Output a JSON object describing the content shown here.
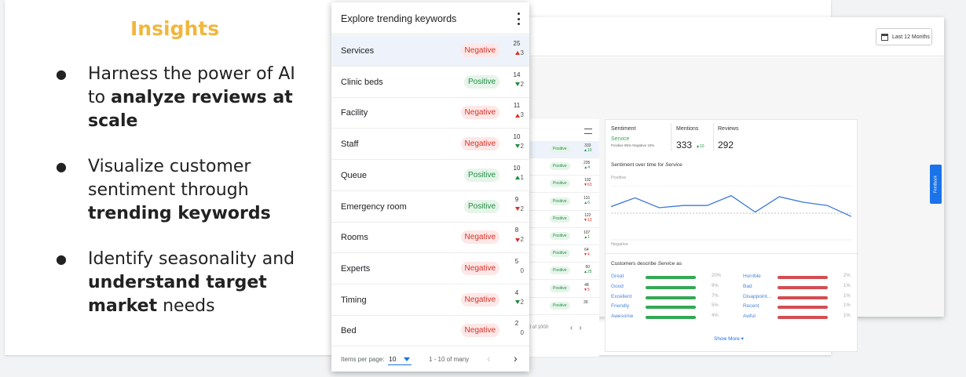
{
  "slide": {
    "title": "Insights",
    "bullets": [
      {
        "parts": [
          {
            "t": "Harness the power of AI to ",
            "b": false
          },
          {
            "t": "analyze reviews at scale",
            "b": true
          }
        ]
      },
      {
        "parts": [
          {
            "t": "Visualize customer sentiment through ",
            "b": false
          },
          {
            "t": "trending keywords",
            "b": true
          }
        ]
      },
      {
        "parts": [
          {
            "t": "Identify seasonality and ",
            "b": false
          },
          {
            "t": "understand target market",
            "b": true
          },
          {
            "t": " needs",
            "b": false
          }
        ]
      }
    ]
  },
  "panel": {
    "title": "Explore trending keywords",
    "rows": [
      {
        "label": "Services",
        "sentiment": "Negative",
        "count": "25",
        "delta": "3",
        "dir": "up-red",
        "selected": true
      },
      {
        "label": "Clinic beds",
        "sentiment": "Positive",
        "count": "14",
        "delta": "2",
        "dir": "down-green",
        "selected": false
      },
      {
        "label": "Facility",
        "sentiment": "Negative",
        "count": "11",
        "delta": "3",
        "dir": "up-red",
        "selected": false
      },
      {
        "label": "Staff",
        "sentiment": "Negative",
        "count": "10",
        "delta": "2",
        "dir": "down-green",
        "selected": false
      },
      {
        "label": "Queue",
        "sentiment": "Positive",
        "count": "10",
        "delta": "1",
        "dir": "up-green",
        "selected": false
      },
      {
        "label": "Emergency room",
        "sentiment": "Positive",
        "count": "9",
        "delta": "2",
        "dir": "down-red",
        "selected": false
      },
      {
        "label": "Rooms",
        "sentiment": "Negative",
        "count": "8",
        "delta": "2",
        "dir": "down-red",
        "selected": false
      },
      {
        "label": "Experts",
        "sentiment": "Negative",
        "count": "5",
        "delta": "0",
        "dir": "none",
        "selected": false
      },
      {
        "label": "Timing",
        "sentiment": "Negative",
        "count": "4",
        "delta": "2",
        "dir": "down-green",
        "selected": false
      },
      {
        "label": "Bed",
        "sentiment": "Negative",
        "count": "2",
        "delta": "0",
        "dir": "none",
        "selected": false
      }
    ],
    "footer": {
      "items_per_page_label": "Items per page:",
      "items_per_page_value": "10",
      "range": "1 - 10 of many",
      "prev": "‹",
      "next": "›"
    }
  },
  "dashboard": {
    "date_button": "Last 12 Months",
    "table_rows": [
      {
        "pill": "Positive",
        "count": "333",
        "delta": "10",
        "dir": "up"
      },
      {
        "pill": "Positive",
        "count": "235",
        "delta": "4",
        "dir": "up"
      },
      {
        "pill": "Positive",
        "count": "192",
        "delta": "63",
        "dir": "down"
      },
      {
        "pill": "Positive",
        "count": "131",
        "delta": "6",
        "dir": "up"
      },
      {
        "pill": "Positive",
        "count": "122",
        "delta": "13",
        "dir": "down"
      },
      {
        "pill": "Positive",
        "count": "107",
        "delta": "1",
        "dir": "up"
      },
      {
        "pill": "Positive",
        "count": "64",
        "delta": "4",
        "dir": "down"
      },
      {
        "pill": "Positive",
        "count": "60",
        "delta": "25",
        "dir": "up"
      },
      {
        "pill": "Positive",
        "count": "48",
        "delta": "5",
        "dir": "down"
      },
      {
        "pill": "Positive",
        "count": "39",
        "delta": "",
        "dir": "none"
      }
    ],
    "table_range": "- 10 of 1000",
    "detail": {
      "sentiment_head": "Sentiment",
      "mentions_head": "Mentions",
      "reviews_head": "Reviews",
      "service_name": "Service",
      "service_split": "Positive 85%  Negative 15%",
      "mentions": "333",
      "mentions_delta": "▲10",
      "reviews": "292",
      "sot_title": "Sentiment over time for",
      "sot_keyword": "Service",
      "pos_label": "Positive",
      "neg_label": "Negative",
      "trend": [
        0.62,
        0.78,
        0.6,
        0.64,
        0.64,
        0.82,
        0.52,
        0.8,
        0.7,
        0.64,
        0.44
      ],
      "customers_title": "Customers describe",
      "customers_keyword": "Service",
      "customers_suffix": "as",
      "positive_words": [
        {
          "w": "Great",
          "p": "20%"
        },
        {
          "w": "Good",
          "p": "9%"
        },
        {
          "w": "Excellent",
          "p": "7%"
        },
        {
          "w": "Friendly",
          "p": "5%"
        },
        {
          "w": "Awesome",
          "p": "4%"
        }
      ],
      "negative_words": [
        {
          "w": "Horrible",
          "p": "2%"
        },
        {
          "w": "Bad",
          "p": "1%"
        },
        {
          "w": "Disappoint...",
          "p": "1%"
        },
        {
          "w": "Recent",
          "p": "1%"
        },
        {
          "w": "Awful",
          "p": "1%"
        }
      ],
      "show_more": "Show More ▾",
      "colors": {
        "positive": "#34a853",
        "negative": "#d44d52"
      }
    },
    "feedback_tab": "Feedback"
  }
}
